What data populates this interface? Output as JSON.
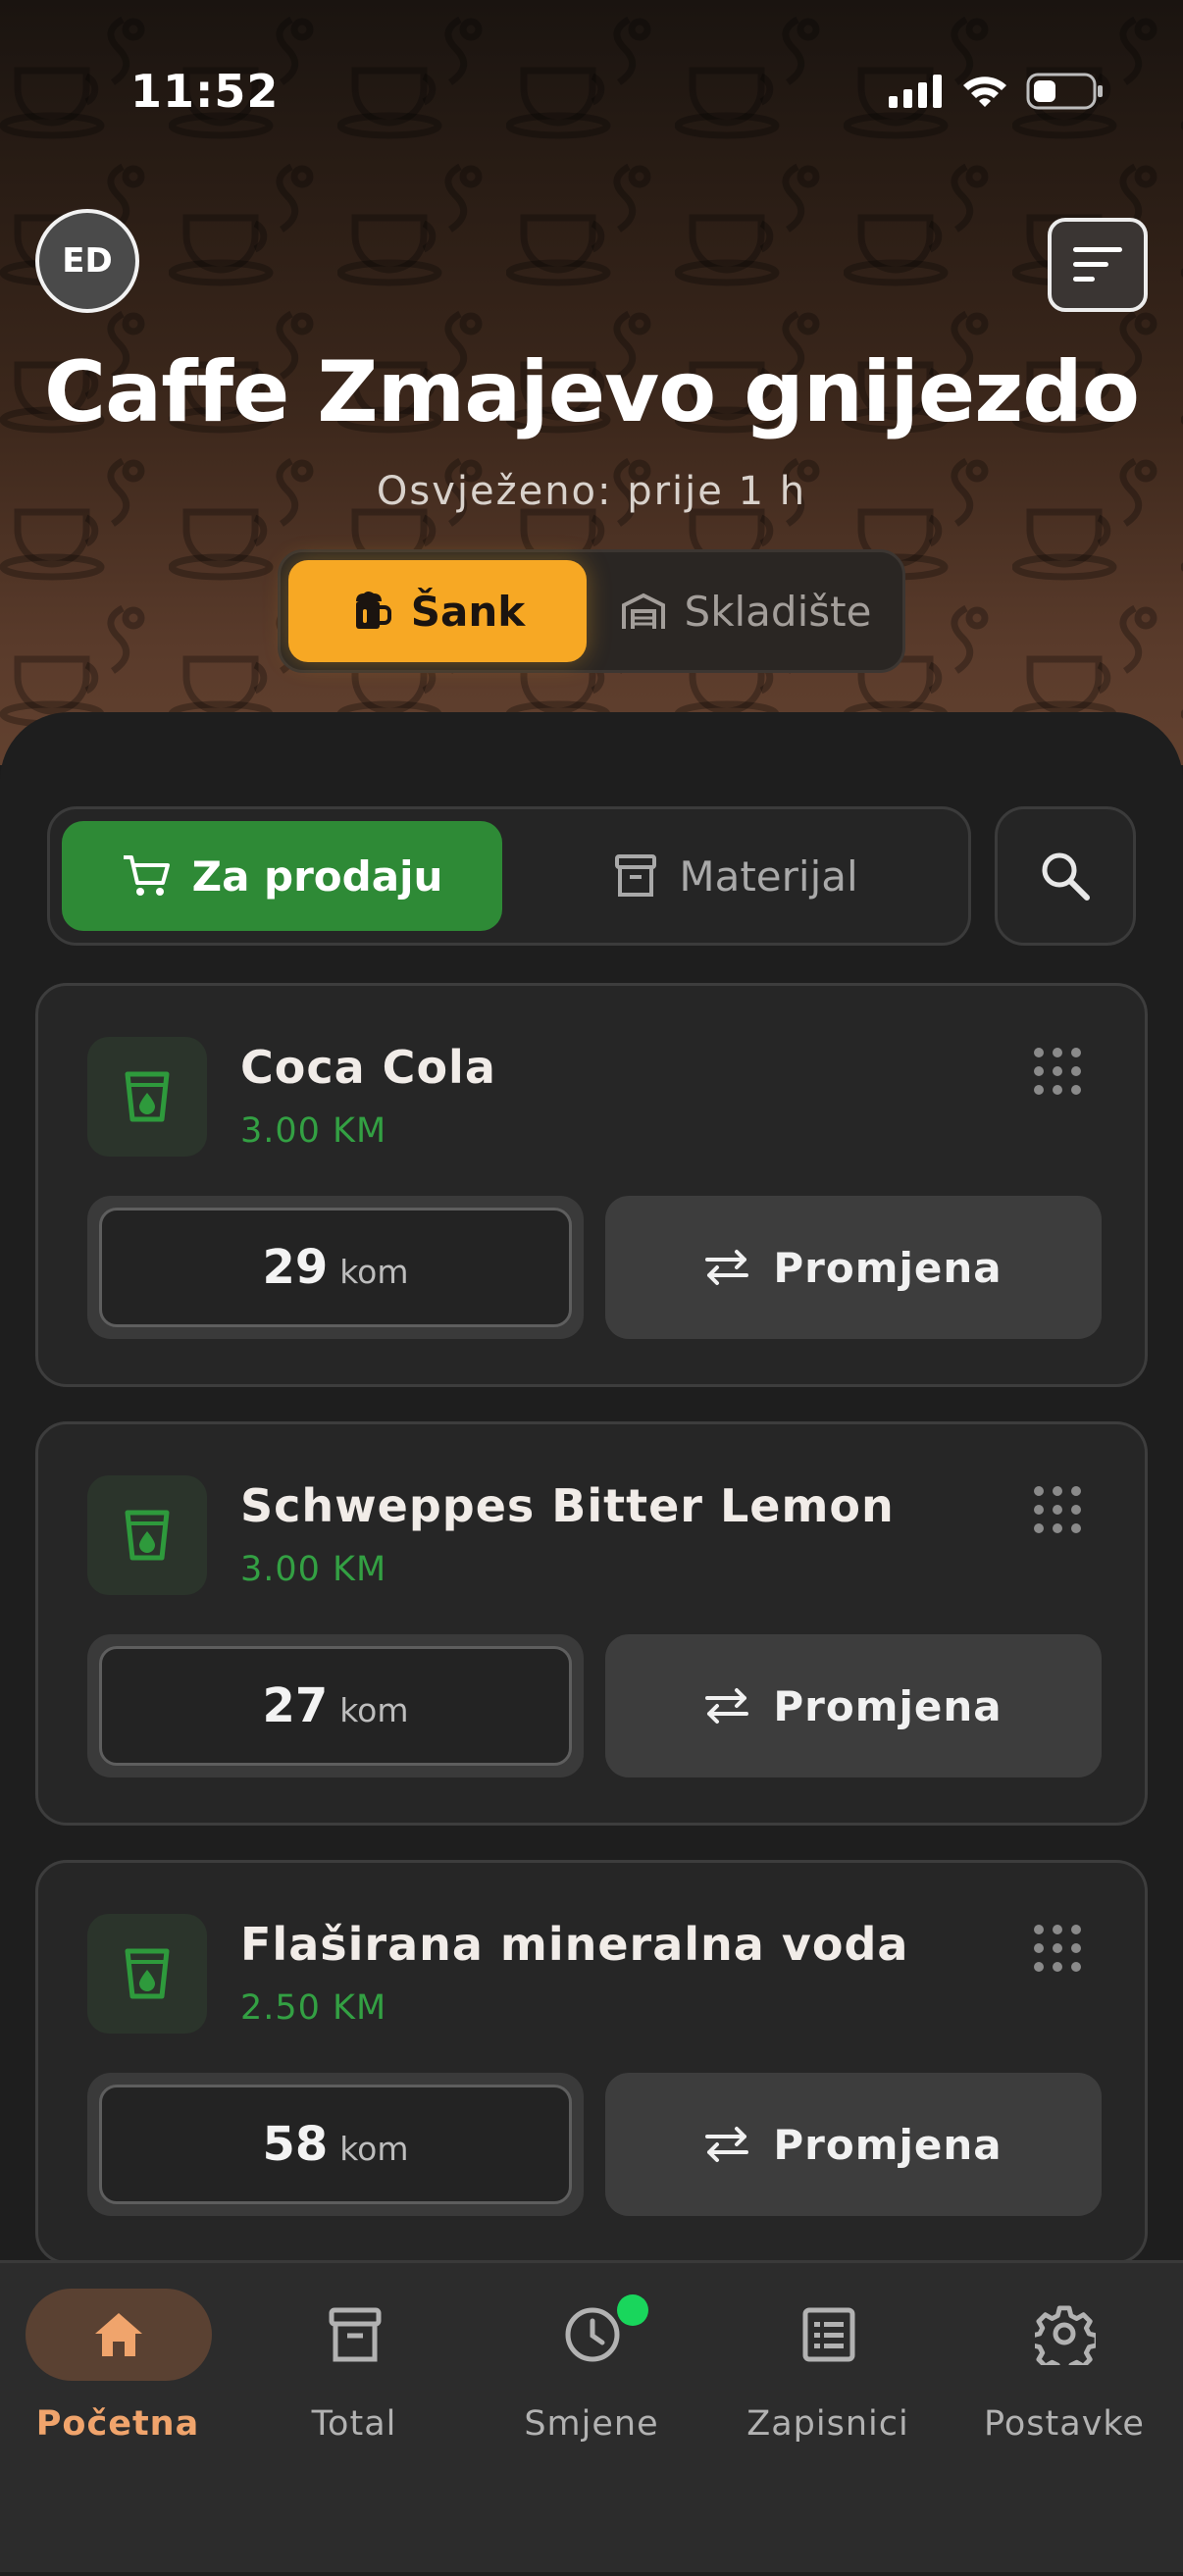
{
  "status_bar": {
    "time": "11:52"
  },
  "header": {
    "avatar_initials": "ED",
    "venue_name": "Caffe Zmajevo gnijezdo",
    "refresh_text": "Osvježeno: prije 1 h",
    "location_tabs": [
      {
        "label": "Šank",
        "icon": "beer-mug-icon",
        "active": true
      },
      {
        "label": "Skladište",
        "icon": "warehouse-icon",
        "active": false
      }
    ]
  },
  "category_tabs": [
    {
      "label": "Za prodaju",
      "icon": "cart-icon",
      "active": true
    },
    {
      "label": "Materijal",
      "icon": "archive-icon",
      "active": false
    }
  ],
  "products": [
    {
      "name": "Coca Cola",
      "price": "3.00 KM",
      "quantity": "29",
      "unit": "kom",
      "action": "Promjena"
    },
    {
      "name": "Schweppes Bitter Lemon",
      "price": "3.00 KM",
      "quantity": "27",
      "unit": "kom",
      "action": "Promjena"
    },
    {
      "name": "Flaširana mineralna voda",
      "price": "2.50 KM",
      "quantity": "58",
      "unit": "kom",
      "action": "Promjena"
    }
  ],
  "bottom_nav": [
    {
      "label": "Početna",
      "icon": "home-icon",
      "active": true
    },
    {
      "label": "Total",
      "icon": "archive-icon",
      "active": false
    },
    {
      "label": "Smjene",
      "icon": "clock-icon",
      "active": false,
      "badge": true
    },
    {
      "label": "Zapisnici",
      "icon": "list-icon",
      "active": false
    },
    {
      "label": "Postavke",
      "icon": "gear-icon",
      "active": false
    }
  ],
  "colors": {
    "accent_orange": "#f7a824",
    "accent_green": "#2e8a36",
    "price_green": "#33a043",
    "nav_active": "#f0a46c",
    "badge_green": "#19d65c"
  }
}
